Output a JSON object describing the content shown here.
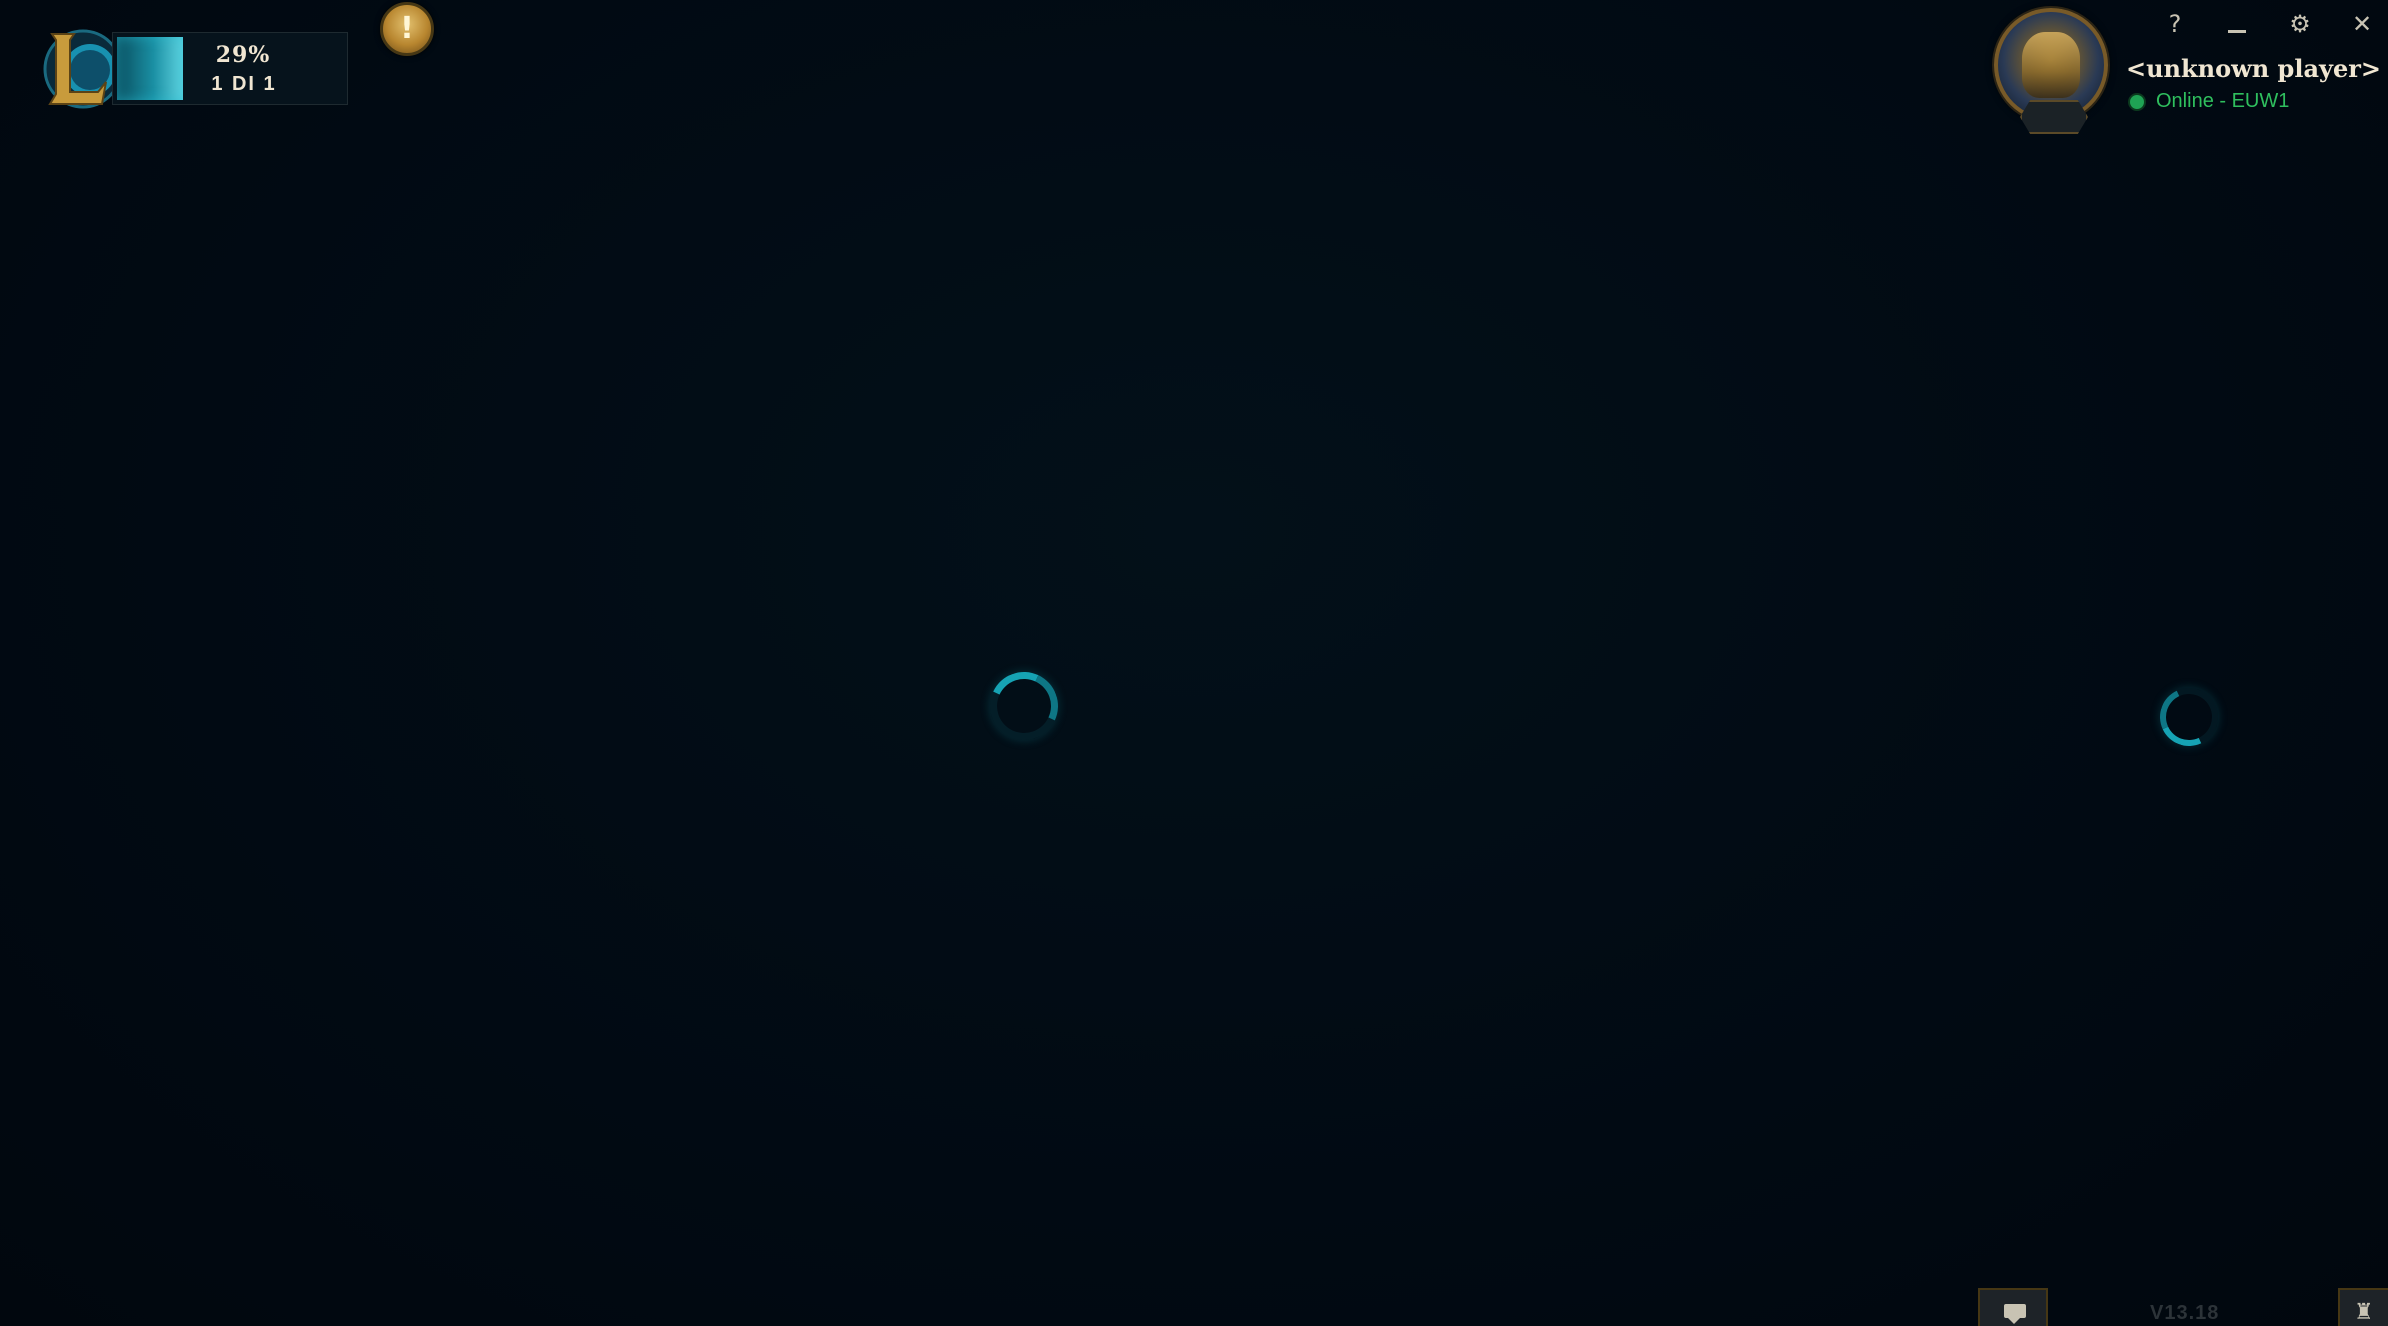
{
  "patcher": {
    "percent": "29%",
    "progress_fraction": 0.29,
    "count": "1 DI 1"
  },
  "alert": {
    "symbol": "!",
    "icon": "exclamation-icon"
  },
  "window_controls": {
    "help": "?",
    "settings": "⚙",
    "close": "✕"
  },
  "profile": {
    "name": "<unknown player>",
    "status": "Online - EUW1",
    "status_color": "#2fbf5e"
  },
  "footer": {
    "version": "V13.18",
    "chat_icon": "chat-bubble-icon",
    "social_icon": "friends-icon",
    "social_symbol": "♜"
  },
  "colors": {
    "background": "#010a13",
    "accent_teal": "#16a3b4",
    "gold": "#c89b3c",
    "text": "#f0e6d2"
  }
}
